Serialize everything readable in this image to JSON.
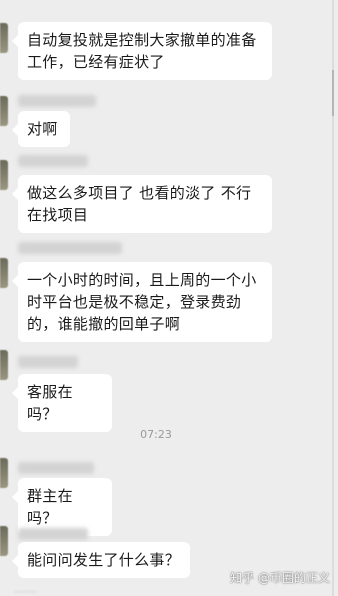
{
  "messages": [
    {
      "text": "自动复投就是控制大家撤单的准备工作，已经有症状了"
    },
    {
      "text": "对啊"
    },
    {
      "text": "做这么多项目了 也看的淡了 不行在找项目"
    },
    {
      "text": "一个小时的时间，且上周的一个小时平台也是极不稳定，登录费劲的，谁能撤的回单子啊"
    },
    {
      "text": "客服在吗？"
    },
    {
      "text": "群主在吗？"
    },
    {
      "text": "能问问发生了什么事？"
    }
  ],
  "timestamp": "07:23",
  "watermark": "知乎 @币圈的正义"
}
